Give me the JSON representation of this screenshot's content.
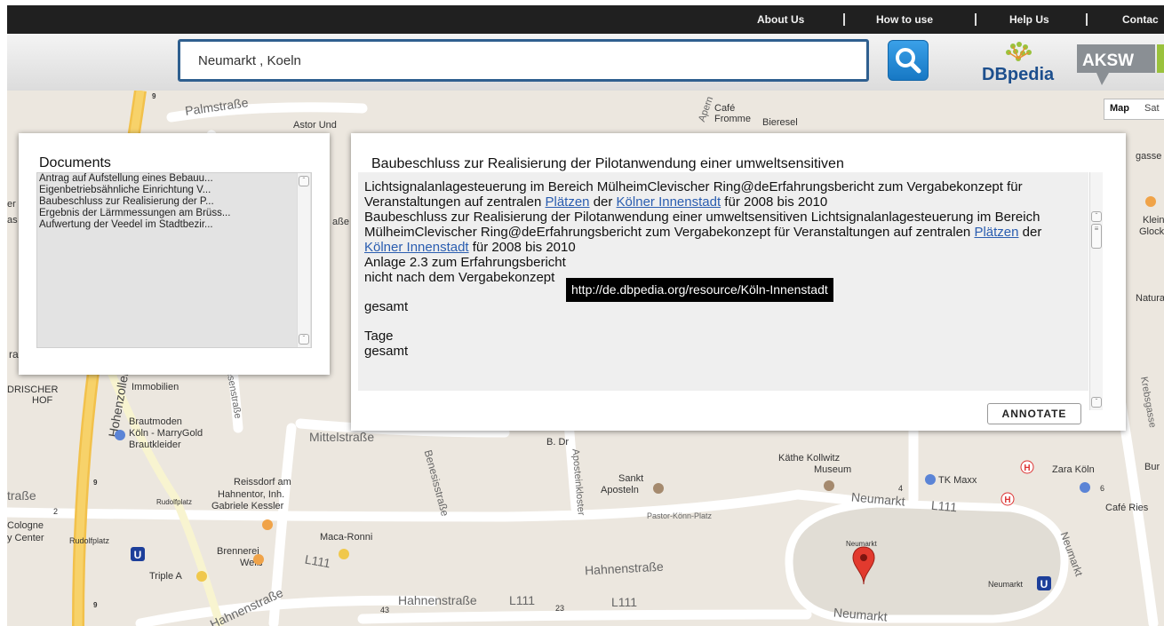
{
  "nav": {
    "about": "About Us",
    "howto": "How to use",
    "help": "Help Us",
    "contact": "Contac"
  },
  "search": {
    "value": "Neumarkt , Koeln"
  },
  "logos": {
    "dbpedia": "DBpedia",
    "aksw": "AKSW"
  },
  "map": {
    "type_buttons": [
      "Map",
      "Sat"
    ],
    "streets": [
      "Palmstraße",
      "Mittelstraße",
      "Hahnenstraße",
      "Hahnenstraße",
      "Neumarkt",
      "L111",
      "L111",
      "L111",
      "Hohenzollernring",
      "Aposteinkloster",
      "Benesisstraße",
      "Neumarkt",
      "Hahnenstraße",
      "L111",
      "Krebsgasse",
      "Friesenstraße",
      "traße",
      "Neumarkt",
      "Apern"
    ],
    "places": [
      "Café",
      "Fromme",
      "Bieresel",
      "Astor Und",
      "Brautmoden",
      "Köln - MarryGold",
      "Brautkleider",
      "Reissdorf am",
      "Hahnentor, Inh.",
      "Gabriele Kessler",
      "Maca-Ronni",
      "Brennerei",
      "Weiß",
      "Triple A",
      "Sankt",
      "Aposteln",
      "Pastor-Könn-Platz",
      "Käthe Kollwitz",
      "Museum",
      "TK Maxx",
      "Zara Köln",
      "Café Ries",
      "Neumarkt",
      "Neumarkt",
      "Rudolfplatz",
      "Rudolfplatz",
      "Cologne",
      "y Center",
      "Immobilien",
      "DRISCHER",
      "HOF",
      "gasse",
      "Klein",
      "Glock",
      "Naturat",
      "Bur",
      "B. Dr",
      "43",
      "23",
      "9",
      "9",
      "9",
      "2",
      "6",
      "4",
      "ral",
      "er",
      "as",
      "aße"
    ]
  },
  "documents": {
    "title": "Documents",
    "items": [
      "Antrag auf Aufstellung eines Bebauu...",
      "Eigenbetriebsähnliche Einrichtung V...",
      "Baubeschluss zur Realisierung der P...",
      "Ergebnis der Lärmmessungen am Brüss...",
      "Aufwertung der Veedel im Stadtbezir..."
    ]
  },
  "text_panel": {
    "title": "Baubeschluss zur Realisierung der Pilotanwendung einer umweltsensitiven",
    "p1a": "Lichtsignalanlagesteuerung im Bereich MülheimClevischer Ring@deErfahrungsbericht zum Vergabekonzept für Veranstaltungen auf zentralen ",
    "link1": "Plätzen",
    "p1b": " der ",
    "link2": "Kölner Innenstadt",
    "p1c": " für 2008 bis 2010",
    "p2a": "Baubeschluss zur Realisierung der Pilotanwendung einer umweltsensitiven Lichtsignalanlagesteuerung im Bereich MülheimClevischer Ring@deErfahrungsbericht zum Vergabekonzept für Veranstaltungen auf zentralen ",
    "link3": "Plätzen",
    "p2b": " der ",
    "link4": "Kölner Innenstadt",
    "p2c": " für 2008 bis 2010",
    "line3": "Anlage 2.3 zum Erfahrungsbericht",
    "line4": "nicht nach dem Vergabekonzept",
    "line5": "gesamt",
    "line6": "Tage",
    "line7": "gesamt",
    "annotate": "ANNOTATE"
  },
  "tooltip": "http://de.dbpedia.org/resource/Köln-Innenstadt"
}
